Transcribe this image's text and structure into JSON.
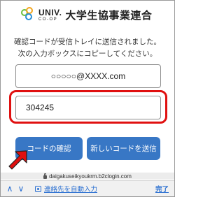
{
  "header": {
    "logo_univ": "UNIV.",
    "logo_coop": "CO-OP",
    "title": "大学生協事業連合"
  },
  "instruction": {
    "line1": "確認コードが受信トレイに送信されました。",
    "line2": "次の入力ボックスにコピーしてください。"
  },
  "form": {
    "email_value": "○○○○○@XXXX.com",
    "code_value": "304245"
  },
  "buttons": {
    "confirm_label": "コードの確認",
    "resend_label": "新しいコードを送信"
  },
  "browser": {
    "url": "daigakuseikyoukrm.b2clogin.com"
  },
  "toolbar": {
    "up_glyph": "∧",
    "down_glyph": "∨",
    "autofill_label": "連絡先を自動入力",
    "done_label": "完了"
  },
  "colors": {
    "button_bg": "#3877c5",
    "highlight": "#e01010",
    "link": "#2a6fd1"
  }
}
